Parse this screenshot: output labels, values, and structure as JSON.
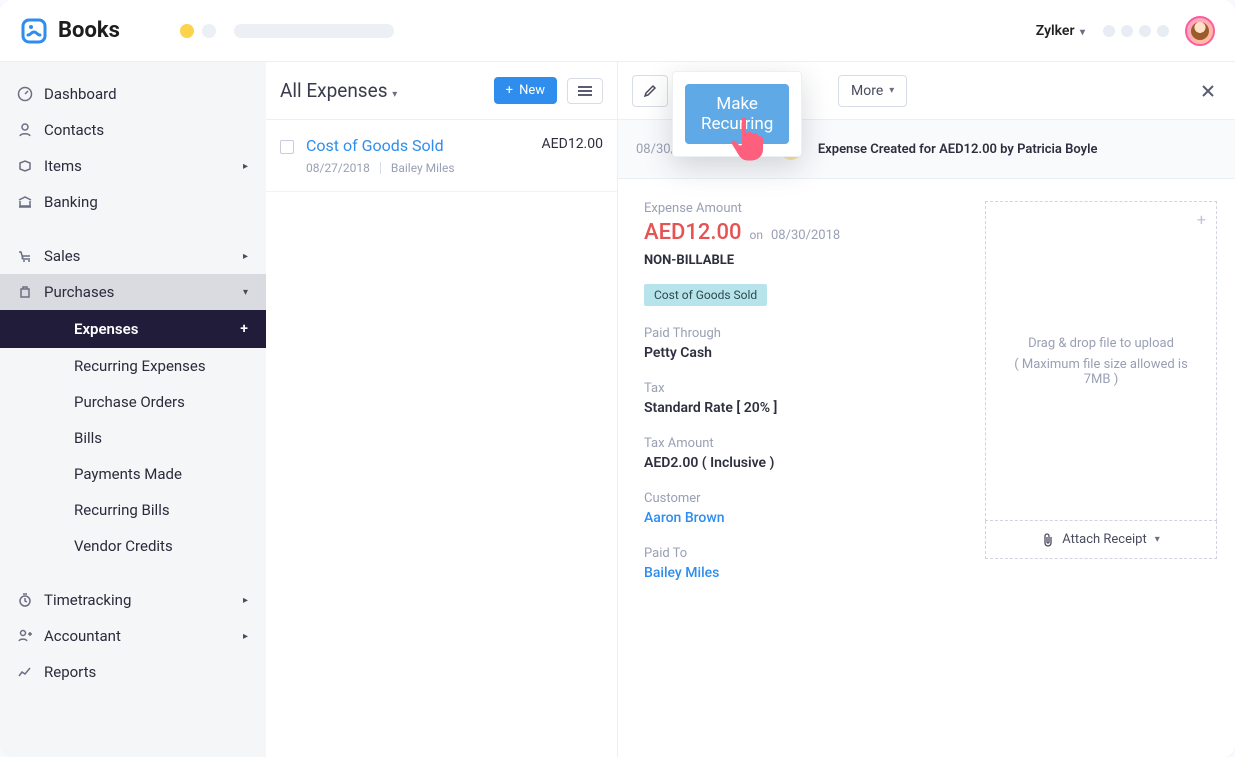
{
  "brand": "Books",
  "org": "Zylker",
  "sidebar": {
    "dashboard": "Dashboard",
    "contacts": "Contacts",
    "items": "Items",
    "banking": "Banking",
    "sales": "Sales",
    "purchases": "Purchases",
    "expenses": "Expenses",
    "recurring_expenses": "Recurring Expenses",
    "purchase_orders": "Purchase Orders",
    "bills": "Bills",
    "payments_made": "Payments Made",
    "recurring_bills": "Recurring Bills",
    "vendor_credits": "Vendor Credits",
    "timetracking": "Timetracking",
    "accountant": "Accountant",
    "reports": "Reports"
  },
  "list": {
    "title": "All Expenses",
    "new_btn": "New",
    "row": {
      "title": "Cost of Goods Sold",
      "date": "08/27/2018",
      "user": "Bailey Miles",
      "amount": "AED12.00"
    }
  },
  "toolbar": {
    "more": "More",
    "popup_btn": "Make Recurring"
  },
  "audit": {
    "ts": "08/30/2018 11:27 AM",
    "msg": "Expense Created for AED12.00 by Patricia Boyle"
  },
  "detail": {
    "amount_label": "Expense Amount",
    "amount": "AED12.00",
    "on": "on",
    "date": "08/30/2018",
    "non_billable": "NON-BILLABLE",
    "category_chip": "Cost of Goods Sold",
    "paid_through_label": "Paid Through",
    "paid_through": "Petty Cash",
    "tax_label": "Tax",
    "tax": "Standard Rate [ 20% ]",
    "tax_amount_label": "Tax Amount",
    "tax_amount": "AED2.00 ( Inclusive )",
    "customer_label": "Customer",
    "customer": "Aaron Brown",
    "paid_to_label": "Paid To",
    "paid_to": "Bailey Miles"
  },
  "upload": {
    "line1": "Drag & drop file to upload",
    "line2": "( Maximum file size allowed is 7MB )",
    "attach": "Attach Receipt"
  }
}
